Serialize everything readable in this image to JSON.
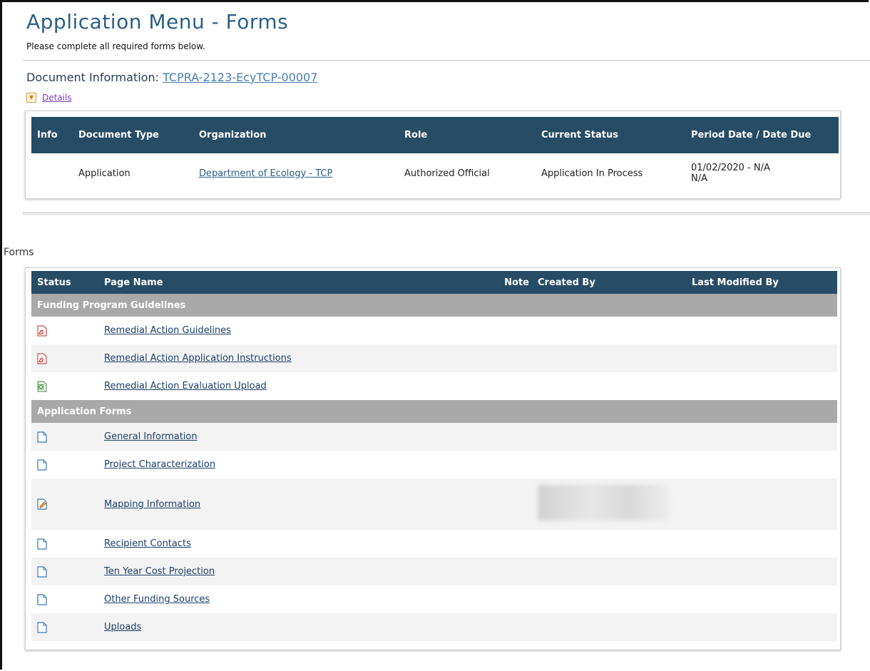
{
  "page": {
    "title": "Application Menu - Forms",
    "subtitle": "Please complete all required forms below."
  },
  "document_info": {
    "label": "Document Information:",
    "document_id": "TCPRA-2123-EcyTCP-00007",
    "details_label": "Details"
  },
  "info_table": {
    "headers": [
      "Info",
      "Document Type",
      "Organization",
      "Role",
      "Current Status",
      "Period Date / Date Due"
    ],
    "row": {
      "info": "",
      "document_type": "Application",
      "organization": "Department of Ecology - TCP",
      "role": "Authorized Official",
      "current_status": "Application In Process",
      "period_date": "01/02/2020 - N/A",
      "date_due": "N/A"
    }
  },
  "forms_section": {
    "label": "Forms",
    "headers": {
      "status": "Status",
      "page_name": "Page Name",
      "note": "Note",
      "created_by": "Created By",
      "last_modified_by": "Last Modified By"
    },
    "groups": [
      {
        "name": "Funding Program Guidelines",
        "items": [
          {
            "icon": "pdf-icon",
            "name": "Remedial Action Guidelines"
          },
          {
            "icon": "pdf-icon",
            "name": "Remedial Action Application Instructions"
          },
          {
            "icon": "excel-icon",
            "name": "Remedial Action Evaluation Upload"
          }
        ]
      },
      {
        "name": "Application Forms",
        "items": [
          {
            "icon": "document-icon",
            "name": "General Information"
          },
          {
            "icon": "document-icon",
            "name": "Project Characterization"
          },
          {
            "icon": "edit-document-icon",
            "name": "Mapping Information"
          },
          {
            "icon": "document-icon",
            "name": "Recipient Contacts"
          },
          {
            "icon": "document-icon",
            "name": "Ten Year Cost Projection"
          },
          {
            "icon": "document-icon",
            "name": "Other Funding Sources"
          },
          {
            "icon": "document-icon",
            "name": "Uploads"
          }
        ]
      }
    ]
  },
  "colors": {
    "header_bg": "#264c66",
    "group_bg": "#a9a9a9",
    "title": "#2b5f86",
    "link": "#1f3f68"
  }
}
